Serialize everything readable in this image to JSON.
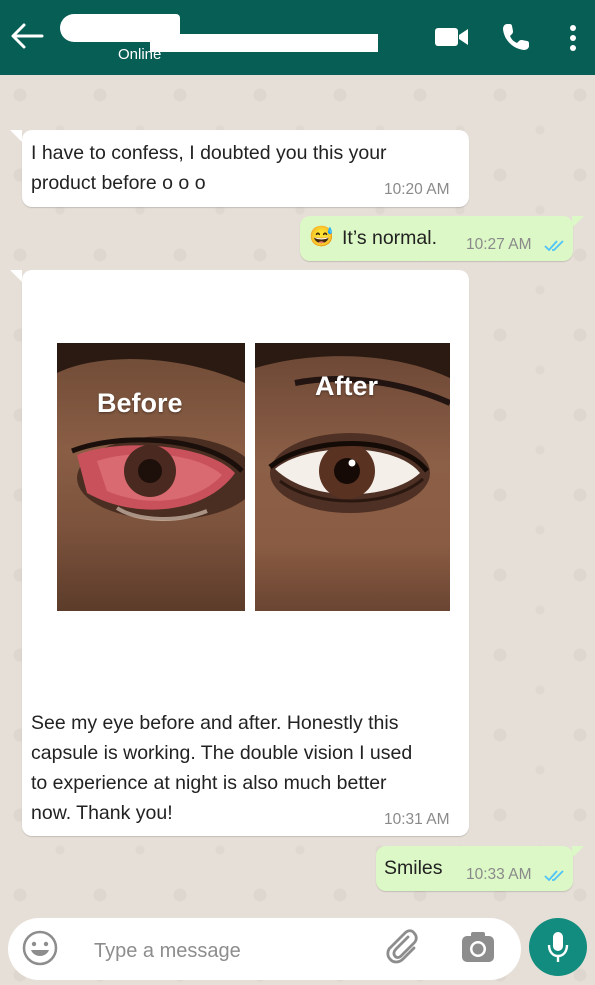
{
  "header": {
    "contact_status": "Online",
    "colors": {
      "bar": "#075e54",
      "icons": "#ffffff"
    },
    "icons": [
      "arrow-left-icon",
      "video-camera-icon",
      "phone-icon",
      "more-vertical-icon"
    ]
  },
  "messages": [
    {
      "direction": "incoming",
      "text_line1": "I have to confess, I doubted you this your",
      "text_line2": "product before o o o",
      "time": "10:20 AM"
    },
    {
      "direction": "outgoing",
      "emoji": "😅",
      "text": "It’s normal.",
      "time": "10:27 AM",
      "read": true
    },
    {
      "direction": "incoming",
      "image": {
        "left_label": "Before",
        "right_label": "After"
      },
      "caption_lines": [
        "See my eye before and after. Honestly this",
        "capsule is working. The double vision I used",
        "to experience at night is also much better",
        "now. Thank you!"
      ],
      "time": "10:31 AM"
    },
    {
      "direction": "outgoing",
      "text": "Smiles",
      "time": "10:33 AM",
      "read": true
    }
  ],
  "composer": {
    "placeholder": "Type a message",
    "icons": [
      "emoji-icon",
      "paperclip-icon",
      "camera-icon",
      "microphone-icon"
    ],
    "mic_color": "#128c7e"
  },
  "colors": {
    "incoming_bubble": "#ffffff",
    "outgoing_bubble": "#dcf8c6",
    "read_ticks": "#4fc3f7",
    "wallpaper": "#e5ddd5"
  }
}
